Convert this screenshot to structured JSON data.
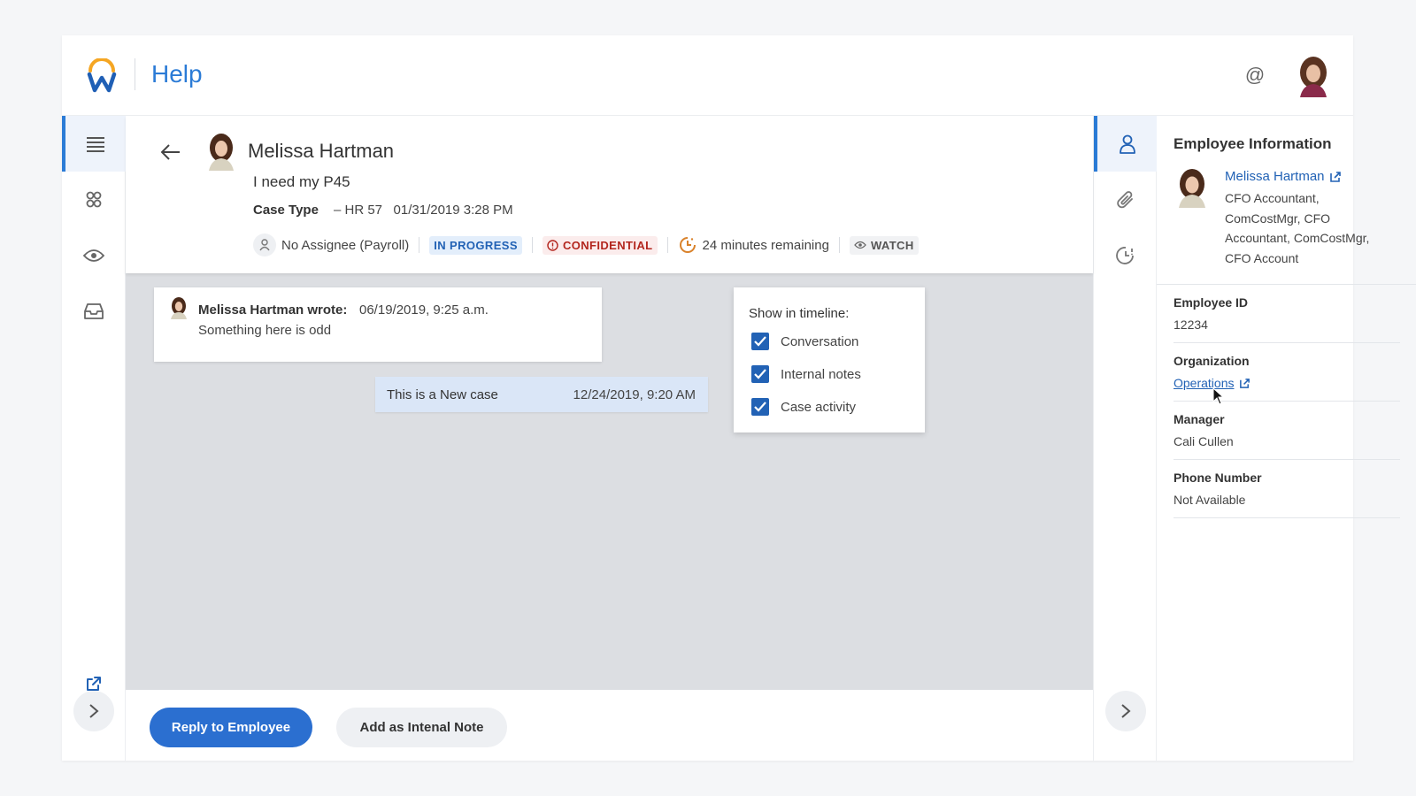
{
  "header": {
    "app_title": "Help",
    "mention_icon": "@"
  },
  "case": {
    "name": "Melissa Hartman",
    "subject": "I need my P45",
    "case_type_label": "Case Type",
    "case_type_value": "– HR 57   01/31/2019 3:28 PM",
    "assignee": "No Assignee (Payroll)",
    "status": "IN PROGRESS",
    "confidential": "CONFIDENTIAL",
    "timer": "24 minutes remaining",
    "watch": "WATCH"
  },
  "timeline": {
    "message": {
      "author": "Melissa Hartman wrote:",
      "time": "06/19/2019, 9:25 a.m.",
      "body": "Something here is odd"
    },
    "activity": {
      "text": "This is a New case",
      "time": "12/24/2019, 9:20 AM"
    },
    "filter": {
      "title": "Show in timeline:",
      "options": [
        {
          "label": "Conversation",
          "checked": true
        },
        {
          "label": "Internal notes",
          "checked": true
        },
        {
          "label": "Case activity",
          "checked": true
        }
      ]
    }
  },
  "footer": {
    "reply_label": "Reply to Employee",
    "note_label": "Add as Intenal Note"
  },
  "employee_info": {
    "title": "Employee Information",
    "name": "Melissa Hartman",
    "role": "CFO Accountant, ComCostMgr, CFO Accountant, ComCostMgr, CFO Account",
    "fields": [
      {
        "label": "Employee ID",
        "value": "12234"
      },
      {
        "label": "Organization",
        "value": "Operations"
      },
      {
        "label": "Manager",
        "value": "Cali Cullen"
      },
      {
        "label": "Phone Number",
        "value": "Not Available"
      }
    ]
  },
  "colors": {
    "accent": "#2b7bd6",
    "primary_button": "#2b6fd0",
    "status_blue": "#2262b5",
    "confidential_red": "#b3261e",
    "timer_orange": "#d9822b",
    "logo_orange": "#f5a623"
  },
  "icons": {
    "left_rail": [
      "menu-icon",
      "people-icon",
      "eye-icon",
      "inbox-icon",
      "open-external-icon",
      "chevron-right-icon"
    ],
    "right_rail": [
      "person-icon",
      "paperclip-icon",
      "history-icon",
      "chevron-right-icon"
    ]
  }
}
